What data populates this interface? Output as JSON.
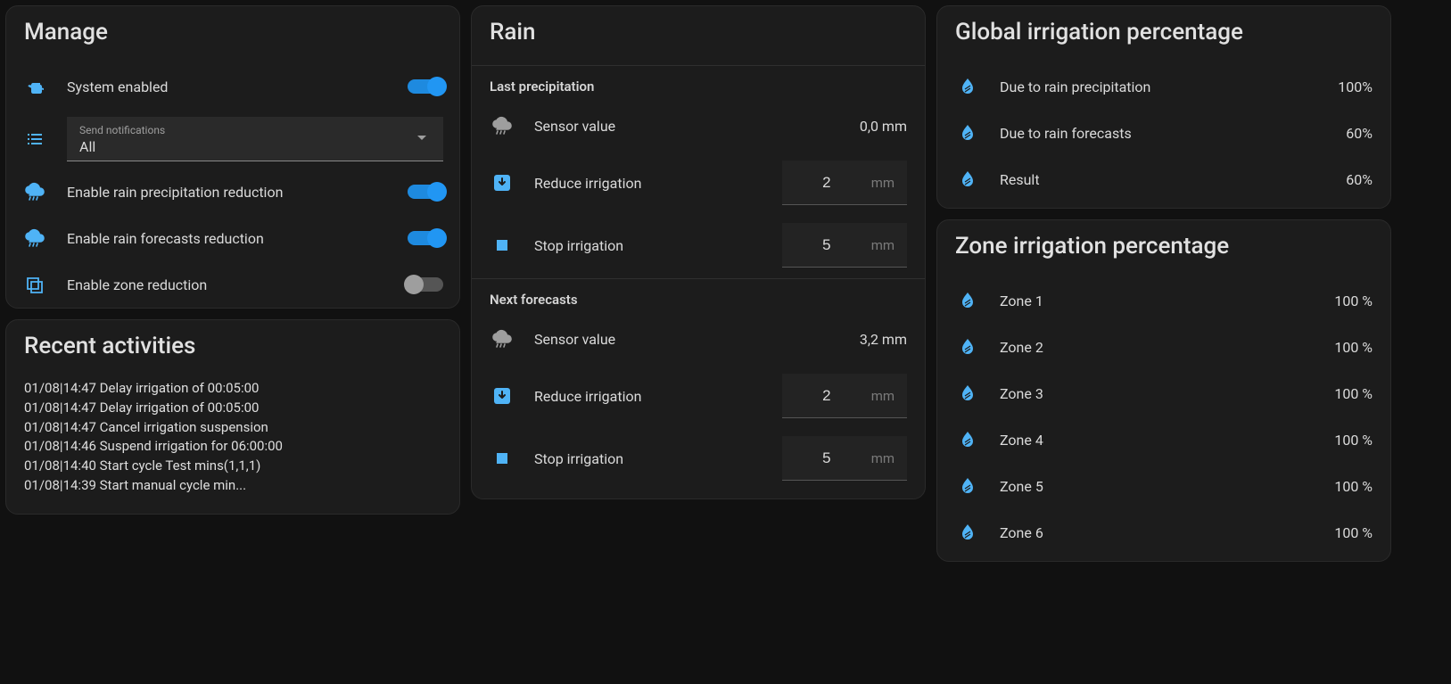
{
  "manage": {
    "title": "Manage",
    "system_enabled": {
      "label": "System enabled",
      "on": true
    },
    "notifications": {
      "label": "Send notifications",
      "value": "All"
    },
    "rain_precip": {
      "label": "Enable rain precipitation reduction",
      "on": true
    },
    "rain_forecast": {
      "label": "Enable rain forecasts reduction",
      "on": true
    },
    "zone_reduction": {
      "label": "Enable zone reduction",
      "on": false
    }
  },
  "activities": {
    "title": "Recent activities",
    "items": [
      "01/08|14:47 Delay irrigation of 00:05:00",
      "01/08|14:47 Delay irrigation of 00:05:00",
      "01/08|14:47 Cancel irrigation suspension",
      "01/08|14:46 Suspend irrigation for 06:00:00",
      "01/08|14:40 Start cycle Test mins(1,1,1)",
      "01/08|14:39 Start manual cycle min..."
    ]
  },
  "rain": {
    "title": "Rain",
    "last": {
      "section": "Last precipitation",
      "sensor_label": "Sensor value",
      "sensor_value": "0,0 mm",
      "reduce_label": "Reduce irrigation",
      "reduce_value": "2",
      "stop_label": "Stop irrigation",
      "stop_value": "5",
      "unit": "mm"
    },
    "next": {
      "section": "Next forecasts",
      "sensor_label": "Sensor value",
      "sensor_value": "3,2 mm",
      "reduce_label": "Reduce irrigation",
      "reduce_value": "2",
      "stop_label": "Stop irrigation",
      "stop_value": "5",
      "unit": "mm"
    }
  },
  "global_pct": {
    "title": "Global irrigation percentage",
    "rows": [
      {
        "label": "Due to rain precipitation",
        "pct": "100%"
      },
      {
        "label": "Due to rain forecasts",
        "pct": "60%"
      },
      {
        "label": "Result",
        "pct": "60%"
      }
    ]
  },
  "zone_pct": {
    "title": "Zone irrigation percentage",
    "rows": [
      {
        "label": "Zone 1",
        "pct": "100 %"
      },
      {
        "label": "Zone 2",
        "pct": "100 %"
      },
      {
        "label": "Zone 3",
        "pct": "100 %"
      },
      {
        "label": "Zone 4",
        "pct": "100 %"
      },
      {
        "label": "Zone 5",
        "pct": "100 %"
      },
      {
        "label": "Zone 6",
        "pct": "100 %"
      }
    ]
  }
}
